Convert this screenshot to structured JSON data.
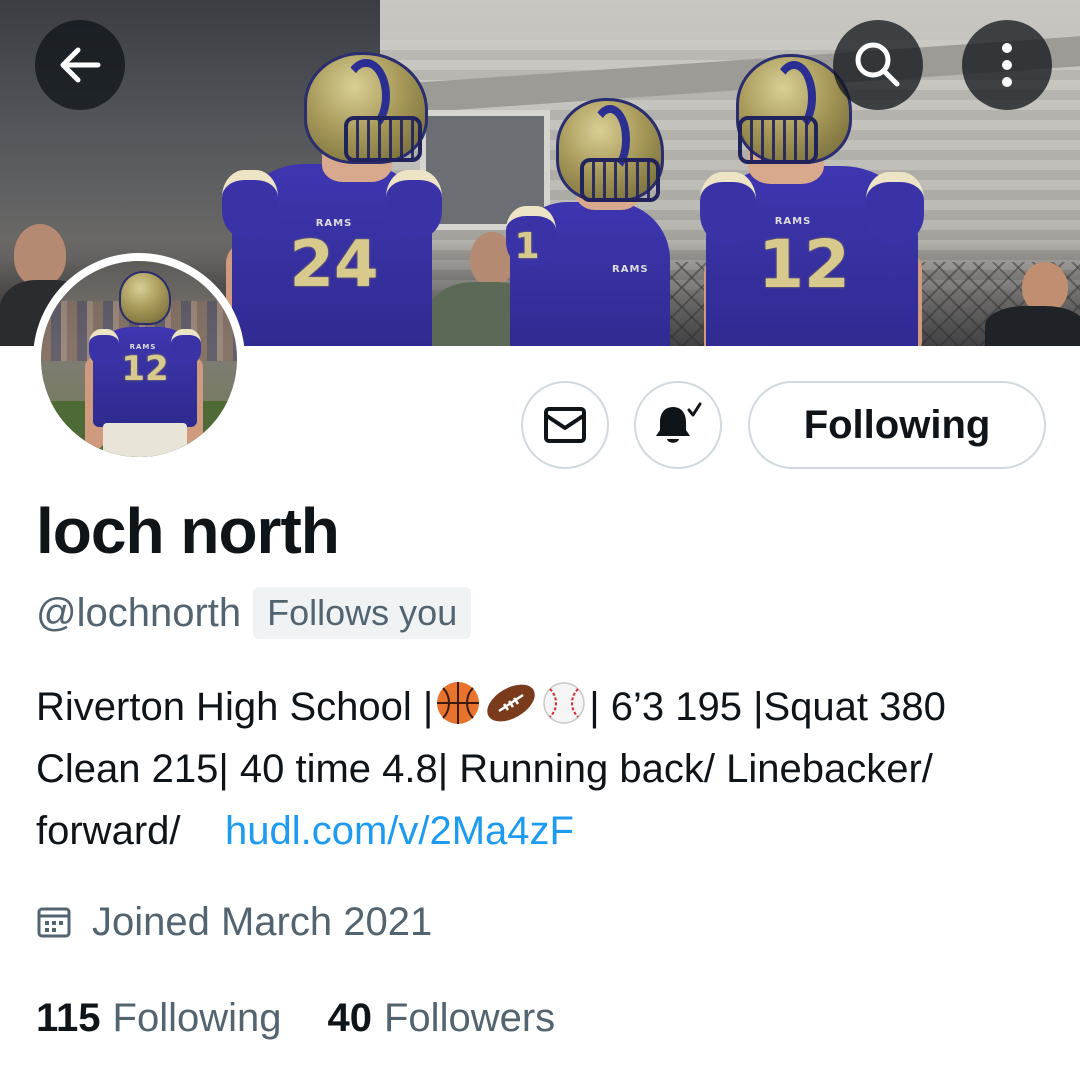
{
  "header": {
    "back_icon": "arrow-left-icon",
    "search_icon": "search-icon",
    "more_icon": "more-vertical-icon"
  },
  "banner": {
    "players": [
      {
        "jersey_word": "RAMS",
        "number": "24"
      },
      {
        "jersey_word": "RAMS",
        "number": "1"
      },
      {
        "jersey_word": "RAMS",
        "number": "12"
      }
    ]
  },
  "avatar": {
    "jersey_word": "RAMS",
    "number": "12"
  },
  "actions": {
    "message_icon": "mail-icon",
    "notify_icon": "bell-check-icon",
    "follow_label": "Following"
  },
  "profile": {
    "display_name": "loch north",
    "handle": "@lochnorth",
    "follows_you": "Follows you",
    "bio_part1": "Riverton High School |",
    "bio_emojis": [
      "basketball",
      "football",
      "baseball"
    ],
    "bio_part2": "| 6’3 195 |Squat 380 Clean 215| 40 time 4.8| Running back/ Linebacker/ forward/",
    "bio_link": "hudl.com/v/2Ma4zF",
    "joined_icon": "calendar-icon",
    "joined": "Joined March 2021"
  },
  "stats": {
    "following_count": "115",
    "following_label": "Following",
    "followers_count": "40",
    "followers_label": "Followers"
  },
  "colors": {
    "link": "#1d9bf0",
    "secondary_text": "#536471",
    "primary_text": "#0f1419",
    "border": "#cfd9de",
    "jersey": "#2e2a8e",
    "helmet_gold": "#a89a5a"
  }
}
